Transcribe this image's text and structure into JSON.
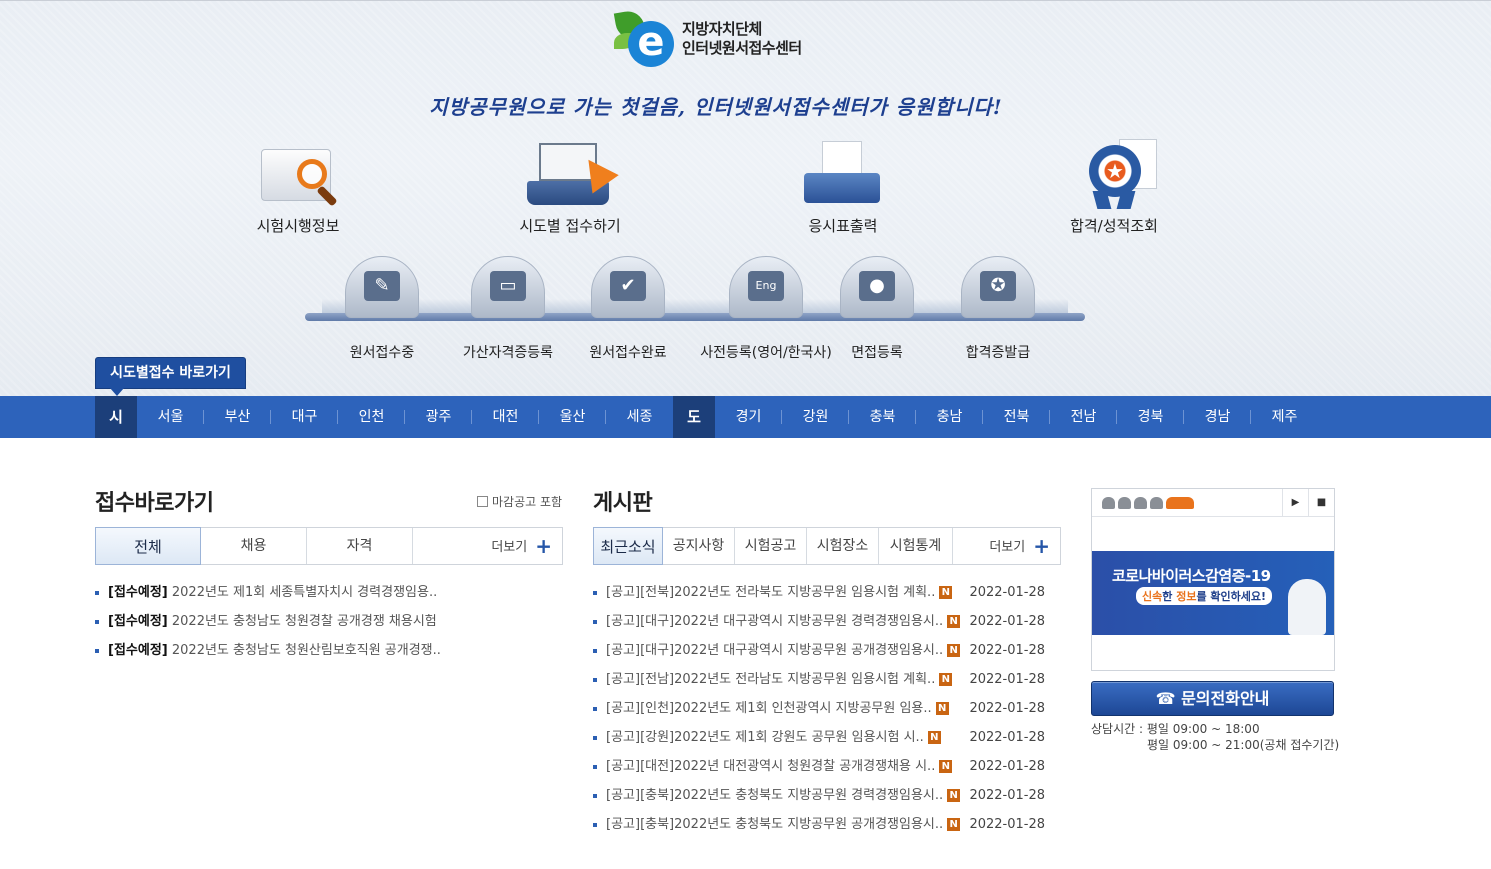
{
  "header": {
    "logo_line1": "지방자치단체",
    "logo_line2": "인터넷원서접수센터",
    "slogan": "지방공무원으로 가는 첫걸음, 인터넷원서접수센터가 응원합니다!"
  },
  "main_menu": [
    {
      "label": "시험시행정보",
      "icon": "folder-magnifier-icon"
    },
    {
      "label": "시도별 접수하기",
      "icon": "laptop-cursor-icon"
    },
    {
      "label": "응시표출력",
      "icon": "printer-icon"
    },
    {
      "label": "합격/성적조회",
      "icon": "medal-certificate-icon"
    }
  ],
  "sub_menu": [
    {
      "label": "원서접수중",
      "glyph": "✎"
    },
    {
      "label": "가산자격증등록",
      "glyph": "▭"
    },
    {
      "label": "원서접수완료",
      "glyph": "✔"
    },
    {
      "label": "사전등록(영어/한국사)",
      "glyph": "Eng"
    },
    {
      "label": "면접등록",
      "glyph": "●"
    },
    {
      "label": "합격증발급",
      "glyph": "✪"
    }
  ],
  "quick_tab": "시도별접수 바로가기",
  "regions": {
    "si_label": "시",
    "si": [
      "서울",
      "부산",
      "대구",
      "인천",
      "광주",
      "대전",
      "울산",
      "세종"
    ],
    "do_label": "도",
    "do": [
      "경기",
      "강원",
      "충북",
      "충남",
      "전북",
      "전남",
      "경북",
      "경남",
      "제주"
    ]
  },
  "reception": {
    "title": "접수바로가기",
    "checkbox_label": "마감공고 포함",
    "tabs": [
      "전체",
      "채용",
      "자격"
    ],
    "more": "더보기",
    "items": [
      {
        "tag": "[접수예정]",
        "text": "2022년도 제1회 세종특별자치시 경력경쟁임용.."
      },
      {
        "tag": "[접수예정]",
        "text": "2022년도 충청남도 청원경찰 공개경쟁 채용시험"
      },
      {
        "tag": "[접수예정]",
        "text": "2022년도 충청남도 청원산림보호직원 공개경쟁.."
      }
    ]
  },
  "board": {
    "title": "게시판",
    "tabs": [
      "최근소식",
      "공지사항",
      "시험공고",
      "시험장소",
      "시험통계"
    ],
    "more": "더보기",
    "badge": "N",
    "items": [
      {
        "text": "[공고][전북]2022년도 전라북도 지방공무원 임용시험 계획..",
        "date": "2022-01-28"
      },
      {
        "text": "[공고][대구]2022년 대구광역시 지방공무원 경력경쟁임용시..",
        "date": "2022-01-28"
      },
      {
        "text": "[공고][대구]2022년 대구광역시 지방공무원 공개경쟁임용시..",
        "date": "2022-01-28"
      },
      {
        "text": "[공고][전남]2022년도 전라남도 지방공무원 임용시험 계획..",
        "date": "2022-01-28"
      },
      {
        "text": "[공고][인천]2022년도 제1회 인천광역시 지방공무원 임용..",
        "date": "2022-01-28"
      },
      {
        "text": "[공고][강원]2022년도 제1회 강원도 공무원 임용시험 시..",
        "date": "2022-01-28"
      },
      {
        "text": "[공고][대전]2022년 대전광역시 청원경찰 공개경쟁채용 시..",
        "date": "2022-01-28"
      },
      {
        "text": "[공고][충북]2022년도 충청북도 지방공무원 경력경쟁임용시..",
        "date": "2022-01-28"
      },
      {
        "text": "[공고][충북]2022년도 충청북도 지방공무원 공개경쟁임용시..",
        "date": "2022-01-28"
      }
    ]
  },
  "banner": {
    "title": "코로나바이러스감염증-19",
    "sub_pre": "신속",
    "sub_mid": "한 ",
    "sub_hl": "정보",
    "sub_post": "를 확인하세요!"
  },
  "contact": {
    "button": "☎ 문의전화안내",
    "hours_line1": "상담시간 : 평일 09:00 ~ 18:00",
    "hours_line2": "평일 09:00 ~ 21:00(공채 접수기간)"
  }
}
